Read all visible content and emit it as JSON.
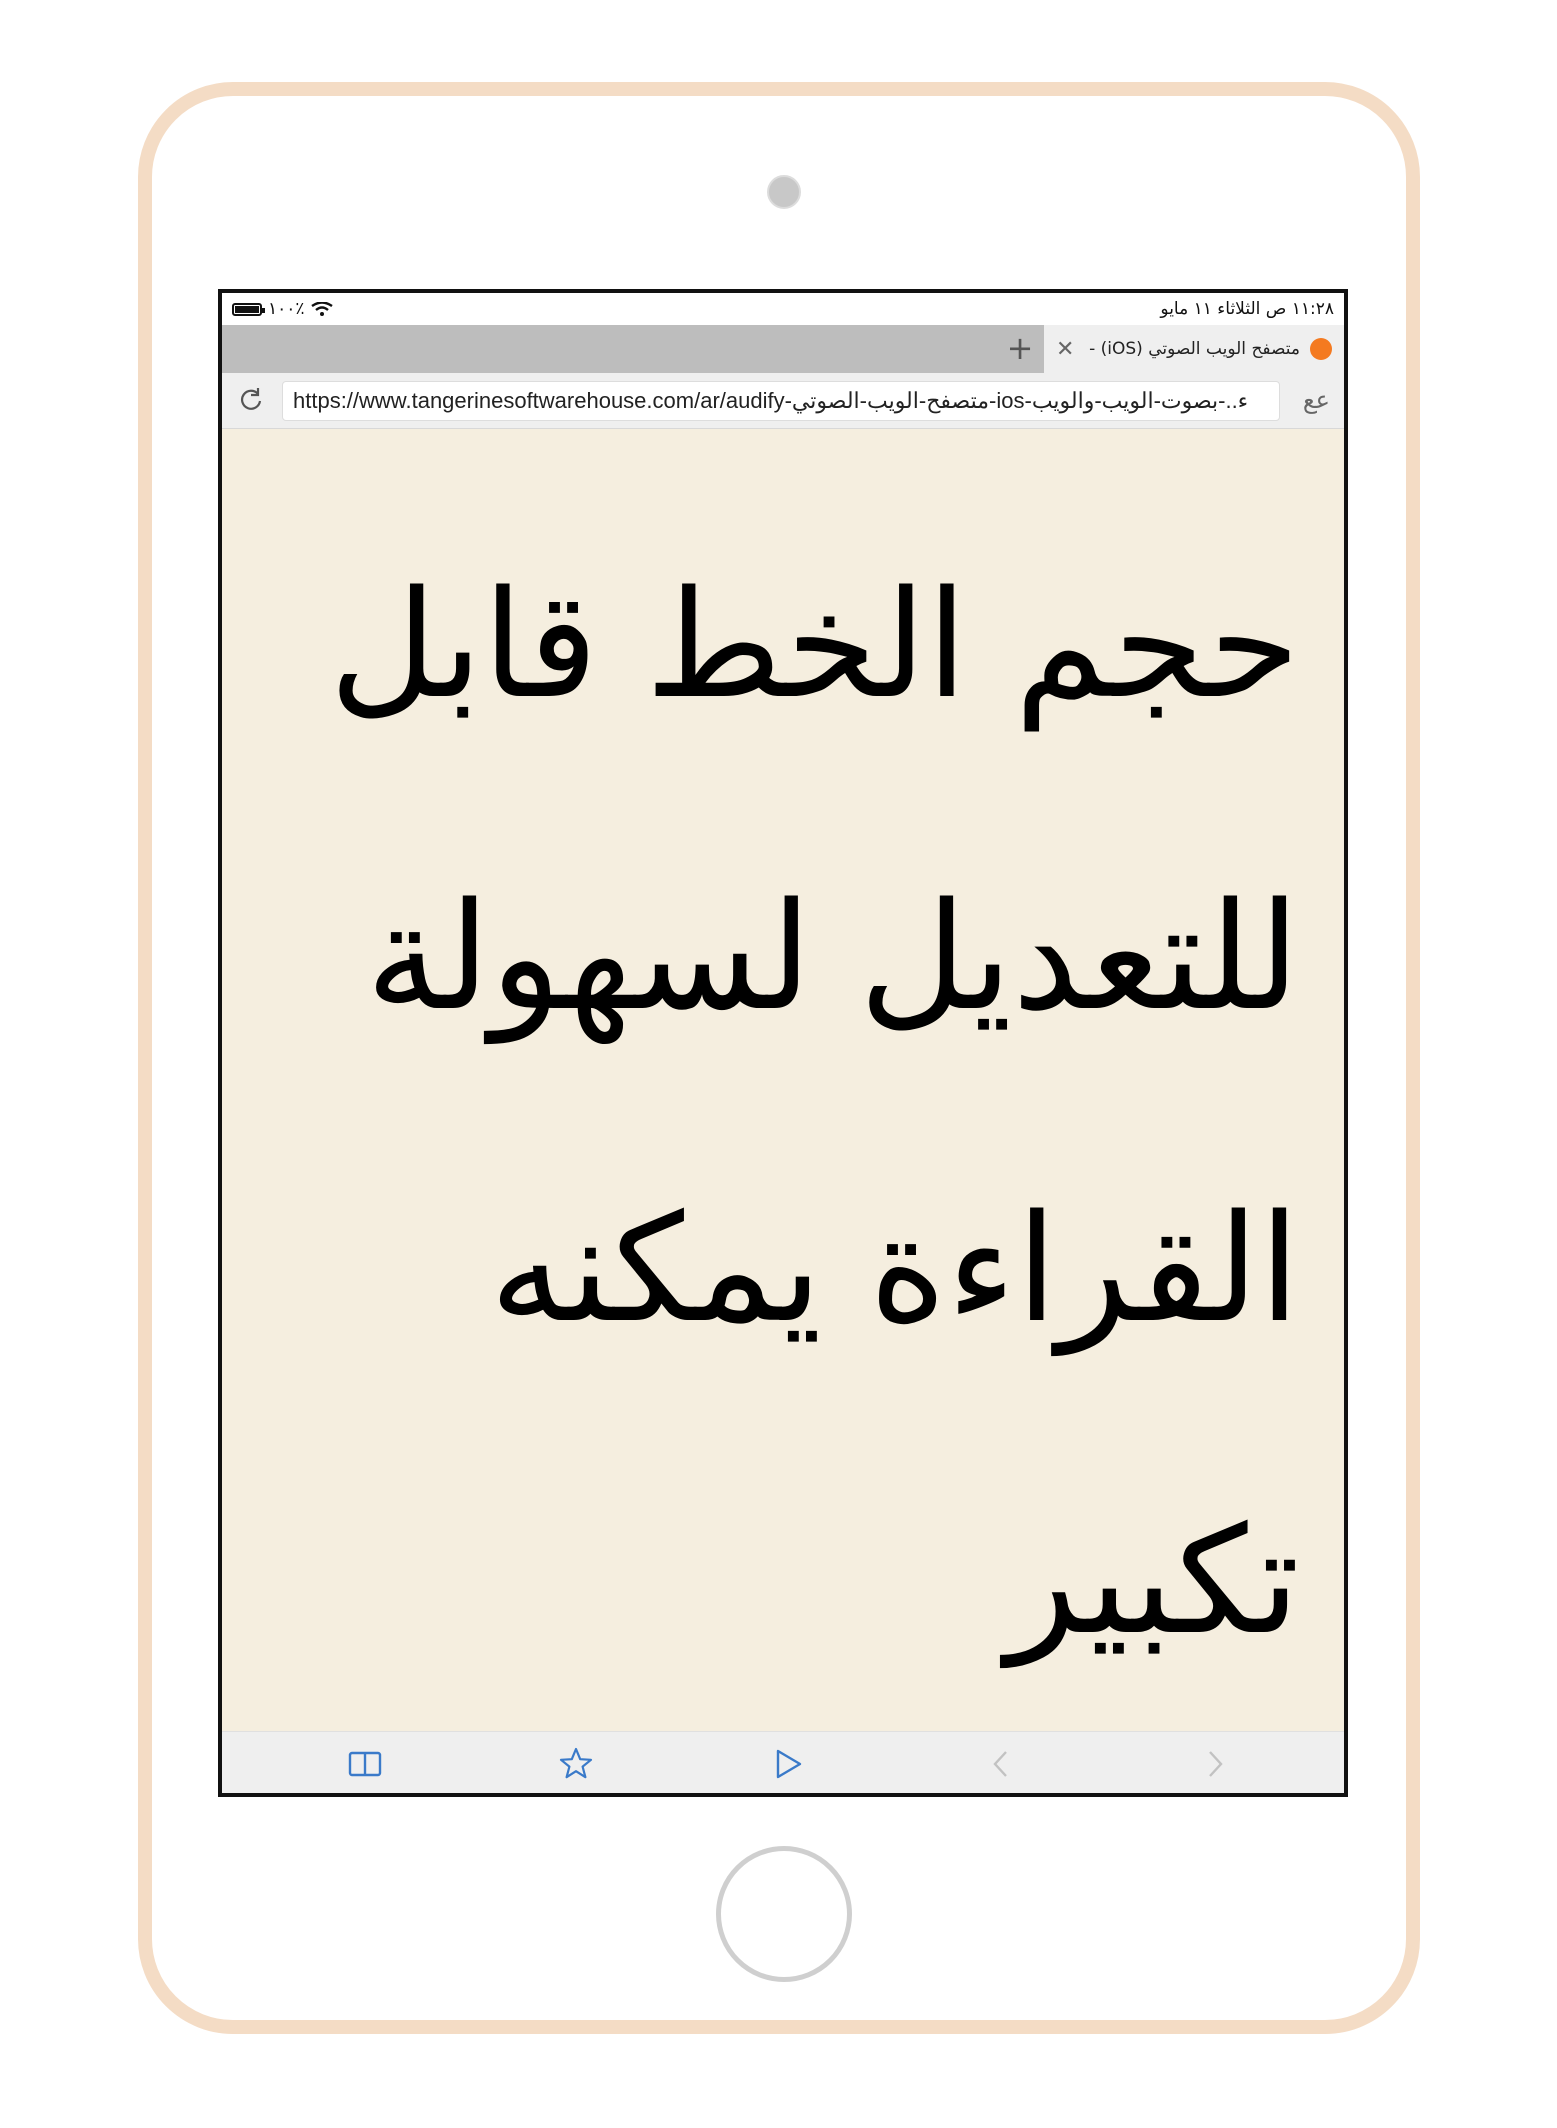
{
  "status_bar": {
    "time_date": "١١:٢٨ ص   الثلاثاء ١١ مايو",
    "battery_percent": "١٠٠٪"
  },
  "tabs": [
    {
      "title": "متصفح الويب الصوتي (iOS) - Audify",
      "active": true
    }
  ],
  "new_tab_label": "+",
  "address": {
    "url": "https://www.tangerinesoftwarehouse.com/ar/audify-متصفح-الويب-الصوتي-ios-ء..-بصوت-الويب-والويب",
    "text_size_label": "عع"
  },
  "content": {
    "text": "حجم الخط قابل للتعديل لسهولة القراءة يمكنه تكبير"
  },
  "toolbar": {
    "icons": [
      "reader-icon",
      "bookmark-star-icon",
      "play-icon",
      "back-icon",
      "forward-icon"
    ]
  },
  "colors": {
    "device_frame": "#f4dcc5",
    "page_background": "#f5eedf",
    "toolbar_icon": "#3a7ac9",
    "favicon": "#f47a20"
  }
}
